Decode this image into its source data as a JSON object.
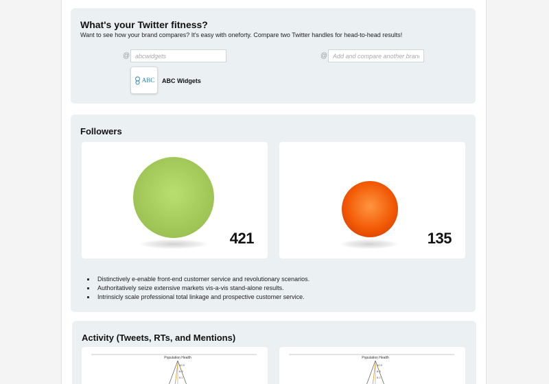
{
  "fitness": {
    "title": "What's your Twitter fitness?",
    "subtitle": "Want to see how your brand compares? It's easy with oneforty. Compare two Twitter handles for head-to-head results!",
    "handle_prefix": "@",
    "handle1": {
      "placeholder": "abcwidgets"
    },
    "handle2": {
      "placeholder": "Add and compare another brand..."
    },
    "brand": {
      "logo_text": "ABC",
      "name": "ABC Widgets"
    }
  },
  "followers": {
    "title": "Followers",
    "left": {
      "count": "421",
      "color": "#a3c95a"
    },
    "right": {
      "count": "135",
      "color": "#f25a05"
    },
    "bullets": [
      "Distinctively e-enable front-end customer service and revolutionary scenarios.",
      "Authoritatively seize extensive markets vis-a-vis stand-alone results.",
      "Intrinsicly scale professional total linkage and prospective customer service."
    ]
  },
  "activity": {
    "title": "Activity (Tweets, RTs, and Mentions)",
    "chart_label": "Population Health",
    "left_ticks": [
      "10.9",
      "8.3",
      "6.2"
    ],
    "right_ticks": [
      "10.9",
      "8.3",
      "6.2"
    ]
  }
}
